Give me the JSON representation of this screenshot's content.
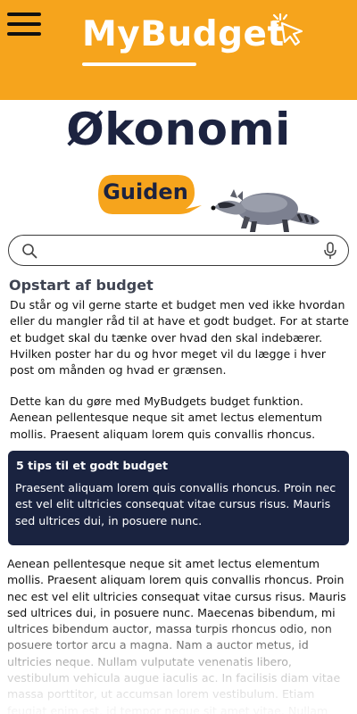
{
  "header": {
    "brand": "MyBudget",
    "menu_icon": "hamburger-menu-icon",
    "cursor_icon": "click-cursor-icon",
    "bg_color": "#f6a41c"
  },
  "hero": {
    "title": "Økonomi",
    "guide_label": "Guiden",
    "mascot": "raccoon-mascot"
  },
  "search": {
    "value": "",
    "placeholder": "",
    "search_icon": "search-icon",
    "mic_icon": "microphone-icon"
  },
  "article": {
    "heading": "Opstart af budget",
    "paragraph1": "Du står og vil gerne starte et budget men ved ikke hvordan eller du mangler råd til at have et godt budget. For at starte et budget skal du tænke over hvad den skal indebærer. Hvilken poster har du og hvor meget vil du lægge i hver post om månden og hvad er grænsen.",
    "paragraph2": "Dette kan du gøre med MyBudgets budget funktion. Aenean pellentesque neque sit amet lectus elementum mollis. Praesent aliquam lorem quis convallis rhoncus.",
    "tips_title": "5 tips til et godt budget",
    "tips_body": "Praesent aliquam lorem quis convallis rhoncus. Proin nec est vel elit ultricies consequat vitae cursus risus. Mauris sed ultrices dui, in posuere nunc.",
    "paragraph3": "Aenean pellentesque neque sit amet lectus elementum mollis. Praesent aliquam lorem quis convallis rhoncus. Proin nec est vel elit ultricies consequat vitae cursus risus. Mauris sed ultrices dui, in posuere nunc. Maecenas bibendum, mi ultrices bibendum auctor, massa turpis rhoncus odio, non posuere tortor arcu a magna. Nam a auctor metus, id ultricies neque. Nullam vulputate venenatis libero, vestibulum vehicula augue iaculis ac. In facilisis diam vitae massa porttitor, ut accumsan lorem vestibulum. Etiam feugiat enim est, id tempor neque sit amet vitae. Nullam"
  },
  "colors": {
    "accent": "#f6a41c",
    "navy": "#1a2340",
    "text": "#111111"
  }
}
